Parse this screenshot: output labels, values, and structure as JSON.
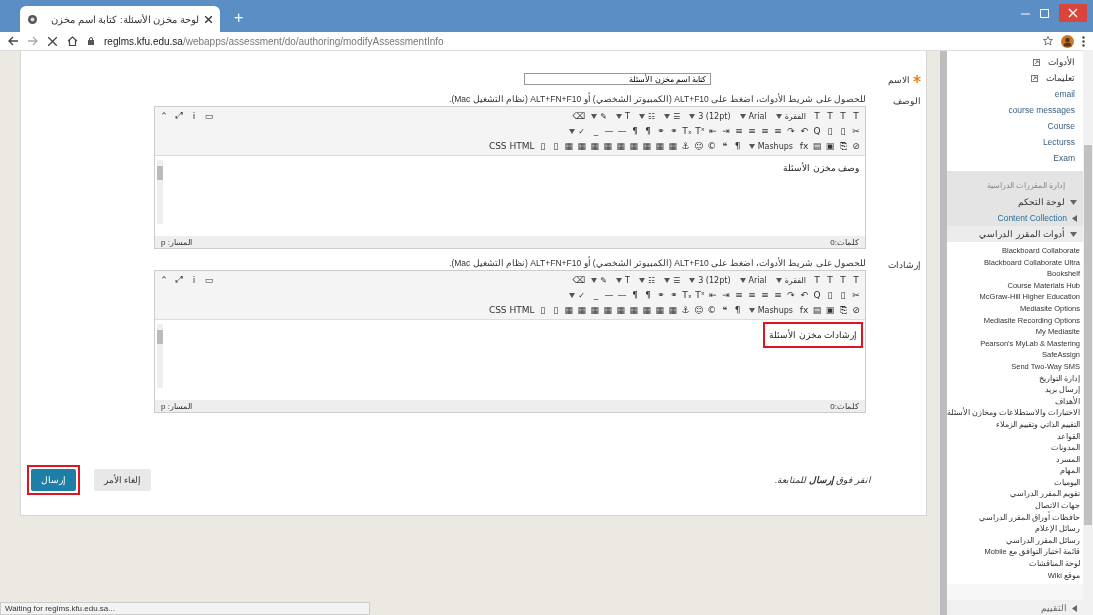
{
  "browser": {
    "tab_title": "لوحة مخزن الأسئلة: كتابة اسم مخزن",
    "new_tab": "+",
    "url_domain": "reglms.kfu.edu.sa",
    "url_path": "/webapps/assessment/do/authoring/modifyAssessmentInfo"
  },
  "form": {
    "fields": [
      {
        "kind": "text",
        "label": "الاسم",
        "required": true,
        "value": "كتابة اسم مخزن الأسئلة"
      },
      {
        "kind": "editor",
        "label": "الوصف",
        "hint": "للحصول على شريط الأدوات، اضغط على ALT+F10 (الكمبيوتر الشخصي) أو ALT+FN+F10 (نظام التشغيل Mac).",
        "toolbar_rows": [
          [
            {
              "kind": "button",
              "text": "T"
            },
            {
              "kind": "button",
              "text": "T"
            },
            {
              "kind": "button",
              "text": "T"
            },
            {
              "kind": "button",
              "text": "T"
            },
            {
              "kind": "select",
              "text": "الفقرة"
            },
            {
              "kind": "select",
              "text": "Arial"
            },
            {
              "kind": "select",
              "text": "(12pt) 3"
            },
            {
              "kind": "select",
              "text": "☰"
            },
            {
              "kind": "select",
              "text": "☷"
            },
            {
              "kind": "select",
              "text": "T"
            },
            {
              "kind": "select",
              "text": "✎"
            },
            {
              "kind": "button",
              "text": "⌫"
            }
          ],
          [
            {
              "kind": "button",
              "text": "✂"
            },
            {
              "kind": "button",
              "text": "▯"
            },
            {
              "kind": "button",
              "text": "▯"
            },
            {
              "kind": "button",
              "text": "Q"
            },
            {
              "kind": "button",
              "text": "↶"
            },
            {
              "kind": "button",
              "text": "↷"
            },
            {
              "kind": "button",
              "text": "≡"
            },
            {
              "kind": "button",
              "text": "≡"
            },
            {
              "kind": "button",
              "text": "≡"
            },
            {
              "kind": "button",
              "text": "≡"
            },
            {
              "kind": "button",
              "text": "⇥"
            },
            {
              "kind": "button",
              "text": "⇤"
            },
            {
              "kind": "button",
              "text": "Tˣ"
            },
            {
              "kind": "button",
              "text": "Tₓ"
            },
            {
              "kind": "button",
              "text": "⚭"
            },
            {
              "kind": "button",
              "text": "⚭"
            },
            {
              "kind": "button",
              "text": "¶"
            },
            {
              "kind": "button",
              "text": "¶"
            },
            {
              "kind": "button",
              "text": "—"
            },
            {
              "kind": "button",
              "text": "—"
            },
            {
              "kind": "button",
              "text": "_"
            },
            {
              "kind": "select",
              "text": "✓"
            }
          ],
          [
            {
              "kind": "button",
              "text": "⊘"
            },
            {
              "kind": "button",
              "text": "⎘"
            },
            {
              "kind": "button",
              "text": "▣"
            },
            {
              "kind": "button",
              "text": "▤"
            },
            {
              "kind": "button",
              "text": "fx"
            },
            {
              "kind": "select",
              "text": "Mashups"
            },
            {
              "kind": "button",
              "text": "¶"
            },
            {
              "kind": "button",
              "text": "❝"
            },
            {
              "kind": "button",
              "text": "©"
            },
            {
              "kind": "button",
              "text": "☺"
            },
            {
              "kind": "button",
              "text": "⚓"
            },
            {
              "kind": "button",
              "text": "▦"
            },
            {
              "kind": "button",
              "text": "▦"
            },
            {
              "kind": "button",
              "text": "▦"
            },
            {
              "kind": "button",
              "text": "▦"
            },
            {
              "kind": "button",
              "text": "▦"
            },
            {
              "kind": "button",
              "text": "▦"
            },
            {
              "kind": "button",
              "text": "▦"
            },
            {
              "kind": "button",
              "text": "▦"
            },
            {
              "kind": "button",
              "text": "▦"
            },
            {
              "kind": "button",
              "text": "▯"
            },
            {
              "kind": "button",
              "text": "▯"
            },
            {
              "kind": "button",
              "text": "HTML"
            },
            {
              "kind": "button",
              "text": "CSS"
            }
          ]
        ],
        "side_tools": [
          "▭",
          "i",
          "⤢",
          "⌃"
        ],
        "content": "وصف مخزن الأسئلة",
        "highlighted": false,
        "words": "كلمات:0",
        "path": "المسار: p"
      },
      {
        "kind": "editor",
        "label": "إرشادات",
        "hint": "للحصول على شريط الأدوات، اضغط على ALT+F10 (الكمبيوتر الشخصي) أو ALT+FN+F10 (نظام التشغيل Mac).",
        "toolbar_rows": [
          [
            {
              "kind": "button",
              "text": "T"
            },
            {
              "kind": "button",
              "text": "T"
            },
            {
              "kind": "button",
              "text": "T"
            },
            {
              "kind": "button",
              "text": "T"
            },
            {
              "kind": "select",
              "text": "الفقرة"
            },
            {
              "kind": "select",
              "text": "Arial"
            },
            {
              "kind": "select",
              "text": "(12pt) 3"
            },
            {
              "kind": "select",
              "text": "☰"
            },
            {
              "kind": "select",
              "text": "☷"
            },
            {
              "kind": "select",
              "text": "T"
            },
            {
              "kind": "select",
              "text": "✎"
            },
            {
              "kind": "button",
              "text": "⌫"
            }
          ],
          [
            {
              "kind": "button",
              "text": "✂"
            },
            {
              "kind": "button",
              "text": "▯"
            },
            {
              "kind": "button",
              "text": "▯"
            },
            {
              "kind": "button",
              "text": "Q"
            },
            {
              "kind": "button",
              "text": "↶"
            },
            {
              "kind": "button",
              "text": "↷"
            },
            {
              "kind": "button",
              "text": "≡"
            },
            {
              "kind": "button",
              "text": "≡"
            },
            {
              "kind": "button",
              "text": "≡"
            },
            {
              "kind": "button",
              "text": "≡"
            },
            {
              "kind": "button",
              "text": "⇥"
            },
            {
              "kind": "button",
              "text": "⇤"
            },
            {
              "kind": "button",
              "text": "Tˣ"
            },
            {
              "kind": "button",
              "text": "Tₓ"
            },
            {
              "kind": "button",
              "text": "⚭"
            },
            {
              "kind": "button",
              "text": "⚭"
            },
            {
              "kind": "button",
              "text": "¶"
            },
            {
              "kind": "button",
              "text": "¶"
            },
            {
              "kind": "button",
              "text": "—"
            },
            {
              "kind": "button",
              "text": "—"
            },
            {
              "kind": "button",
              "text": "_"
            },
            {
              "kind": "select",
              "text": "✓"
            }
          ],
          [
            {
              "kind": "button",
              "text": "⊘"
            },
            {
              "kind": "button",
              "text": "⎘"
            },
            {
              "kind": "button",
              "text": "▣"
            },
            {
              "kind": "button",
              "text": "▤"
            },
            {
              "kind": "button",
              "text": "fx"
            },
            {
              "kind": "select",
              "text": "Mashups"
            },
            {
              "kind": "button",
              "text": "¶"
            },
            {
              "kind": "button",
              "text": "❝"
            },
            {
              "kind": "button",
              "text": "©"
            },
            {
              "kind": "button",
              "text": "☺"
            },
            {
              "kind": "button",
              "text": "⚓"
            },
            {
              "kind": "button",
              "text": "▦"
            },
            {
              "kind": "button",
              "text": "▦"
            },
            {
              "kind": "button",
              "text": "▦"
            },
            {
              "kind": "button",
              "text": "▦"
            },
            {
              "kind": "button",
              "text": "▦"
            },
            {
              "kind": "button",
              "text": "▦"
            },
            {
              "kind": "button",
              "text": "▦"
            },
            {
              "kind": "button",
              "text": "▦"
            },
            {
              "kind": "button",
              "text": "▦"
            },
            {
              "kind": "button",
              "text": "▯"
            },
            {
              "kind": "button",
              "text": "▯"
            },
            {
              "kind": "button",
              "text": "HTML"
            },
            {
              "kind": "button",
              "text": "CSS"
            }
          ]
        ],
        "side_tools": [
          "▭",
          "i",
          "⤢",
          "⌃"
        ],
        "content": "إرشادات مخزن الأسئلة",
        "highlighted": true,
        "words": "كلمات:0",
        "path": "المسار: p"
      }
    ],
    "footer_note": "انقر فوق **إرسال** للمتابعة.",
    "buttons": [
      {
        "label": "إلغاء الأمر",
        "kind": "secondary",
        "highlighted": false
      },
      {
        "label": "إرسال",
        "kind": "primary",
        "highlighted": true
      }
    ]
  },
  "sidebar": {
    "links": [
      {
        "label": "الأدوات",
        "kind": "tool"
      },
      {
        "label": "تعليمات",
        "kind": "tool"
      },
      {
        "label": "email",
        "kind": "link"
      },
      {
        "label": "course messages",
        "kind": "link"
      },
      {
        "label": "Course",
        "kind": "link"
      },
      {
        "label": "Lecturss",
        "kind": "link"
      },
      {
        "label": "Exam",
        "kind": "link"
      }
    ],
    "section_title": "إدارة المقررات الدراسية",
    "menu": [
      {
        "label": "لوحة التحكم",
        "expanded": true
      },
      {
        "label": "Content Collection",
        "expanded": false
      },
      {
        "label": "أدوات المقرر الدراسي",
        "expanded": true,
        "children": [
          "Blackboard Collaborate",
          "Blackboard Collaborate Ultra",
          "Bookshelf",
          "Course Materials Hub",
          "McGraw-Hill Higher Education",
          "Mediasite Options",
          "Mediasite Recording Options",
          "My Mediasite",
          "Pearson's MyLab & Mastering",
          "SafeAssign",
          "Send Two-Way SMS",
          "إدارة التواريخ",
          "إرسال بريد",
          "الأهداف",
          "الاختبارات والاستطلاعات ومخازن الأسئلة",
          "التقييم الذاتي وتقييم الزملاء",
          "القواعد",
          "المدونات",
          "المسرد",
          "المهام",
          "اليوميات",
          "تقويم المقرر الدراسي",
          "جهات الاتصال",
          "حافظات أوراق المقرر الدراسي",
          "رسائل الإعلام",
          "رسائل المقرر الدراسي",
          "قائمة اختبار التوافق مع Mobile",
          "لوحة المناقشات",
          "موقع Wiki"
        ]
      },
      {
        "label": "التقييم",
        "expanded": false
      }
    ]
  },
  "status_bar": "Waiting for reglms.kfu.edu.sa..."
}
